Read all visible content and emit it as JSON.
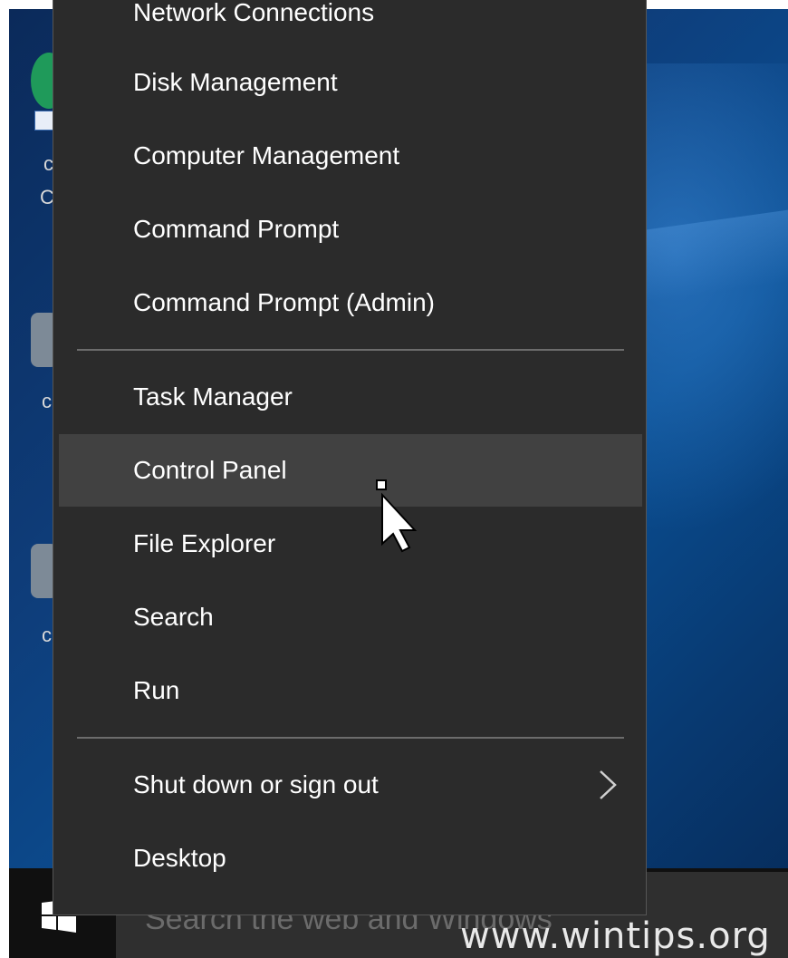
{
  "menu": {
    "items_top": [
      {
        "label": "Network Connections"
      },
      {
        "label": "Disk Management"
      },
      {
        "label": "Computer Management"
      },
      {
        "label": "Command Prompt"
      },
      {
        "label": "Command Prompt (Admin)"
      }
    ],
    "items_mid": [
      {
        "label": "Task Manager"
      },
      {
        "label": "Control Panel"
      },
      {
        "label": "File Explorer"
      },
      {
        "label": "Search"
      },
      {
        "label": "Run"
      }
    ],
    "items_bottom": [
      {
        "label": "Shut down or sign out"
      },
      {
        "label": "Desktop"
      }
    ],
    "hovered_item": "Control Panel"
  },
  "taskbar": {
    "search_placeholder": "Search the web and Windows"
  },
  "watermark": "www.wintips.org",
  "colors": {
    "menu_bg": "#2b2b2b",
    "hover_bg": "#414141",
    "separator": "#6c6c6c",
    "taskbar": "#101010"
  }
}
